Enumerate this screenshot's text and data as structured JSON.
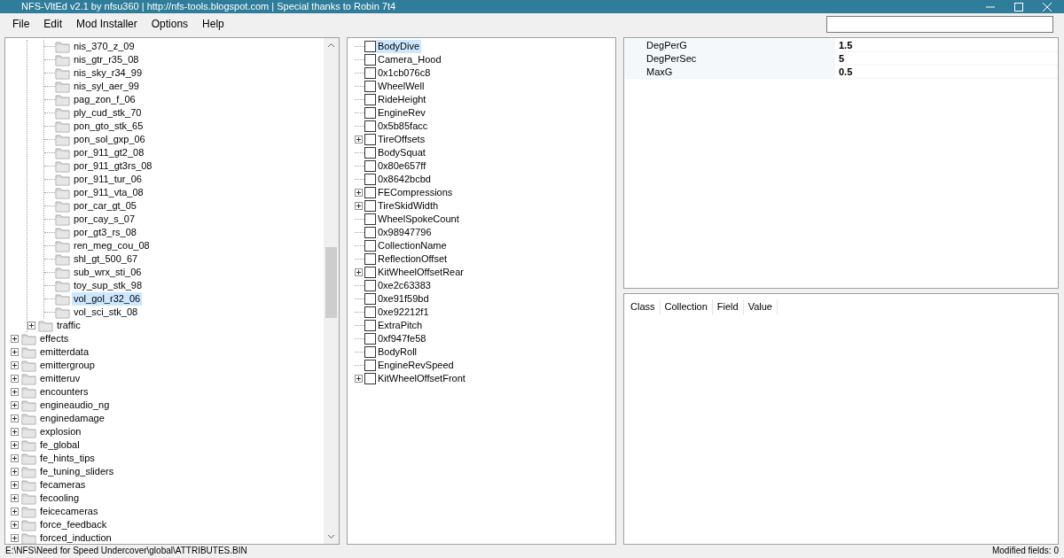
{
  "window": {
    "title": "NFS-VltEd v2.1 by nfsu360 | http://nfs-tools.blogspot.com | Special thanks to Robin 7t4"
  },
  "menu": [
    "File",
    "Edit",
    "Mod Installer",
    "Options",
    "Help"
  ],
  "class_tree": [
    {
      "children": [
        {
          "children": [
            {
              "label": "nis_370_z_09",
              "selected": false
            },
            {
              "label": "nis_gtr_r35_08",
              "selected": false
            },
            {
              "label": "nis_sky_r34_99",
              "selected": false
            },
            {
              "label": "nis_syl_aer_99",
              "selected": false
            },
            {
              "label": "pag_zon_f_06",
              "selected": false
            },
            {
              "label": "ply_cud_stk_70",
              "selected": false
            },
            {
              "label": "pon_gto_stk_65",
              "selected": false
            },
            {
              "label": "pon_sol_gxp_06",
              "selected": false
            },
            {
              "label": "por_911_gt2_08",
              "selected": false
            },
            {
              "label": "por_911_gt3rs_08",
              "selected": false
            },
            {
              "label": "por_911_tur_06",
              "selected": false
            },
            {
              "label": "por_911_vta_08",
              "selected": false
            },
            {
              "label": "por_car_gt_05",
              "selected": false
            },
            {
              "label": "por_cay_s_07",
              "selected": false
            },
            {
              "label": "por_gt3_rs_08",
              "selected": false
            },
            {
              "label": "ren_meg_cou_08",
              "selected": false
            },
            {
              "label": "shl_gt_500_67",
              "selected": false
            },
            {
              "label": "sub_wrx_sti_06",
              "selected": false
            },
            {
              "label": "toy_sup_stk_98",
              "selected": false
            },
            {
              "label": "vol_gol_r32_06",
              "selected": true
            },
            {
              "label": "vol_sci_stk_08",
              "selected": false
            }
          ]
        },
        {
          "label": "traffic",
          "selected": false,
          "expanded": false
        }
      ]
    },
    {
      "label": "effects",
      "selected": false,
      "expanded": false
    },
    {
      "label": "emitterdata",
      "selected": false,
      "expanded": false
    },
    {
      "label": "emittergroup",
      "selected": false,
      "expanded": false
    },
    {
      "label": "emitteruv",
      "selected": false,
      "expanded": false
    },
    {
      "label": "encounters",
      "selected": false,
      "expanded": false
    },
    {
      "label": "engineaudio_ng",
      "selected": false,
      "expanded": false
    },
    {
      "label": "enginedamage",
      "selected": false,
      "expanded": false
    },
    {
      "label": "explosion",
      "selected": false,
      "expanded": false
    },
    {
      "label": "fe_global",
      "selected": false,
      "expanded": false
    },
    {
      "label": "fe_hints_tips",
      "selected": false,
      "expanded": false
    },
    {
      "label": "fe_tuning_sliders",
      "selected": false,
      "expanded": false
    },
    {
      "label": "fecameras",
      "selected": false,
      "expanded": false
    },
    {
      "label": "fecooling",
      "selected": false,
      "expanded": false
    },
    {
      "label": "feicecameras",
      "selected": false,
      "expanded": false
    },
    {
      "label": "force_feedback",
      "selected": false,
      "expanded": false
    },
    {
      "label": "forced_induction",
      "selected": false,
      "expanded": false
    }
  ],
  "field_tree": [
    {
      "label": "BodyDive",
      "checked": false,
      "selected": true,
      "has_children": false
    },
    {
      "label": "Camera_Hood",
      "checked": false,
      "selected": false,
      "has_children": false
    },
    {
      "label": "0x1cb076c8",
      "checked": false,
      "selected": false,
      "has_children": false
    },
    {
      "label": "WheelWell",
      "checked": false,
      "selected": false,
      "has_children": false
    },
    {
      "label": "RideHeight",
      "checked": false,
      "selected": false,
      "has_children": false
    },
    {
      "label": "EngineRev",
      "checked": false,
      "selected": false,
      "has_children": false
    },
    {
      "label": "0x5b85facc",
      "checked": false,
      "selected": false,
      "has_children": false
    },
    {
      "label": "TireOffsets",
      "checked": false,
      "selected": false,
      "has_children": true
    },
    {
      "label": "BodySquat",
      "checked": false,
      "selected": false,
      "has_children": false
    },
    {
      "label": "0x80e657ff",
      "checked": false,
      "selected": false,
      "has_children": false
    },
    {
      "label": "0x8642bcbd",
      "checked": false,
      "selected": false,
      "has_children": false
    },
    {
      "label": "FECompressions",
      "checked": false,
      "selected": false,
      "has_children": true
    },
    {
      "label": "TireSkidWidth",
      "checked": false,
      "selected": false,
      "has_children": true
    },
    {
      "label": "WheelSpokeCount",
      "checked": false,
      "selected": false,
      "has_children": false
    },
    {
      "label": "0x98947796",
      "checked": false,
      "selected": false,
      "has_children": false
    },
    {
      "label": "CollectionName",
      "checked": false,
      "selected": false,
      "has_children": false
    },
    {
      "label": "ReflectionOffset",
      "checked": false,
      "selected": false,
      "has_children": false
    },
    {
      "label": "KitWheelOffsetRear",
      "checked": false,
      "selected": false,
      "has_children": true
    },
    {
      "label": "0xe2c63383",
      "checked": false,
      "selected": false,
      "has_children": false
    },
    {
      "label": "0xe91f59bd",
      "checked": false,
      "selected": false,
      "has_children": false
    },
    {
      "label": "0xe92212f1",
      "checked": false,
      "selected": false,
      "has_children": false
    },
    {
      "label": "ExtraPitch",
      "checked": false,
      "selected": false,
      "has_children": false
    },
    {
      "label": "0xf947fe58",
      "checked": false,
      "selected": false,
      "has_children": false
    },
    {
      "label": "BodyRoll",
      "checked": false,
      "selected": false,
      "has_children": false
    },
    {
      "label": "EngineRevSpeed",
      "checked": false,
      "selected": false,
      "has_children": false
    },
    {
      "label": "KitWheelOffsetFront",
      "checked": false,
      "selected": false,
      "has_children": true
    }
  ],
  "properties": [
    {
      "name": "DegPerG",
      "value": "1.5"
    },
    {
      "name": "DegPerSec",
      "value": "5"
    },
    {
      "name": "MaxG",
      "value": "0.5"
    }
  ],
  "changes_table": {
    "columns": [
      "Class",
      "Collection",
      "Field",
      "Value"
    ]
  },
  "status_bar": {
    "path": "E:\\NFS\\Need for Speed Undercover\\global\\ATTRIBUTES.BIN",
    "modified": "Modified fields: 0"
  }
}
